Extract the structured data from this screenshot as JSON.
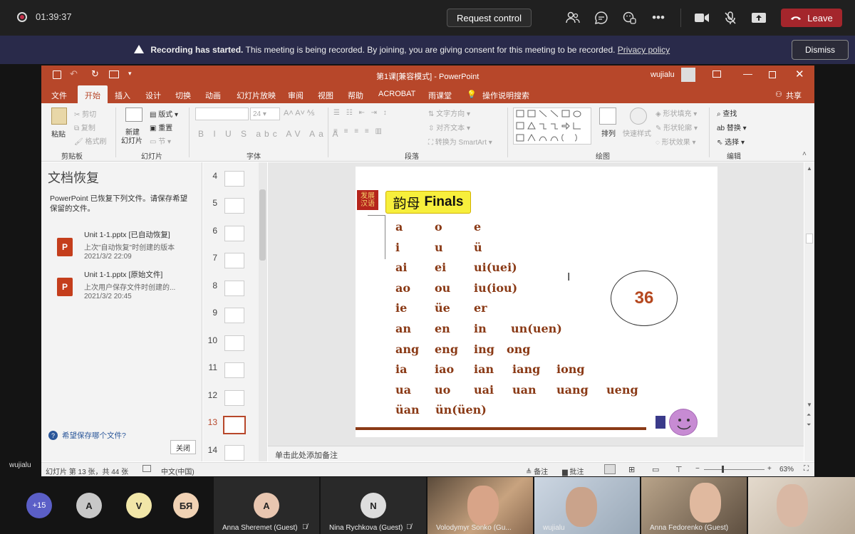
{
  "teams": {
    "timer": "01:39:37",
    "request_control": "Request control",
    "leave": "Leave",
    "banner_bold": "Recording has started.",
    "banner_text": "This meeting is being recorded. By joining, you are giving consent for this meeting to be recorded.",
    "banner_link": "Privacy policy",
    "dismiss": "Dismiss",
    "presenter_label": "wujialu"
  },
  "ppt": {
    "title": "第1课[兼容模式] - PowerPoint",
    "user": "wujialu",
    "tabs": [
      "文件",
      "开始",
      "插入",
      "设计",
      "切换",
      "动画",
      "幻灯片放映",
      "审阅",
      "视图",
      "帮助",
      "ACROBAT",
      "雨课堂",
      "操作说明搜索"
    ],
    "share": "共享",
    "ribbon": {
      "clipboard": {
        "paste": "粘贴",
        "cut": "剪切",
        "copy": "复制",
        "format_painter": "格式刷",
        "label": "剪贴板"
      },
      "slides": {
        "new_slide": "新建",
        "new_slide2": "幻灯片",
        "layout": "版式",
        "reset": "重置",
        "section": "节",
        "label": "幻灯片"
      },
      "font": {
        "size": "24",
        "label": "字体"
      },
      "paragraph": {
        "text_direction": "文字方向",
        "align_text": "对齐文本",
        "smartart": "转换为 SmartArt",
        "label": "段落"
      },
      "drawing": {
        "arrange": "排列",
        "quick_styles": "快速样式",
        "fill": "形状填充",
        "outline": "形状轮廓",
        "effects": "形状效果",
        "label": "绘图"
      },
      "editing": {
        "find": "查找",
        "replace": "替换",
        "select": "选择",
        "label": "编辑"
      }
    },
    "recovery": {
      "title": "文档恢复",
      "desc": "PowerPoint 已恢复下列文件。请保存希望保留的文件。",
      "files": [
        {
          "name": "Unit 1-1.pptx  [已自动恢复]",
          "note": "上次\"自动恢复\"时创建的版本",
          "date": "2021/3/2 22:09"
        },
        {
          "name": "Unit 1-1.pptx  [原始文件]",
          "note": "上次用户保存文件时创建的...",
          "date": "2021/3/2 20:45"
        }
      ],
      "help": "希望保存哪个文件?",
      "close": "关闭"
    },
    "thumbs": [
      "4",
      "5",
      "6",
      "7",
      "8",
      "9",
      "10",
      "11",
      "12",
      "13",
      "14"
    ],
    "notes_placeholder": "单击此处添加备注",
    "status": {
      "slide": "幻灯片 第 13 张，共 44 张",
      "lang": "中文(中国)",
      "notes": "备注",
      "comments": "批注",
      "zoom": "63%"
    }
  },
  "slide": {
    "logo_line1": "发展",
    "logo_line2": "汉语",
    "title_cn": "韵母",
    "title_en": "Finals",
    "rows": [
      [
        "a",
        "o",
        "e"
      ],
      [
        "i",
        "u",
        "ü"
      ],
      [
        "ai",
        "ei",
        "ui(uei)"
      ],
      [
        "ao",
        "ou",
        "iu(iou)"
      ],
      [
        "ie",
        "üe",
        "er"
      ],
      [
        "an",
        "en",
        "in",
        "un(uen)"
      ],
      [
        "ang",
        "eng",
        "ing",
        "ong"
      ],
      [
        "ia",
        "iao",
        "ian",
        "iang",
        "iong"
      ],
      [
        "ua",
        "uo",
        "uai",
        "uan",
        "uang",
        "ueng"
      ],
      [
        "üan",
        "ün(üen)"
      ]
    ],
    "number": "36"
  },
  "participants": {
    "overflow": "+15",
    "avatars": [
      "A",
      "V",
      "БЯ"
    ],
    "tiles": [
      {
        "initial": "A",
        "name": "Anna Sheremet (Guest)"
      },
      {
        "initial": "N",
        "name": "Nina Rychkova (Guest)"
      }
    ],
    "video_names": [
      "Volodymyr Sonko (Gu...",
      "wujialu",
      "Anna Fedorenko (Guest)",
      ""
    ]
  }
}
